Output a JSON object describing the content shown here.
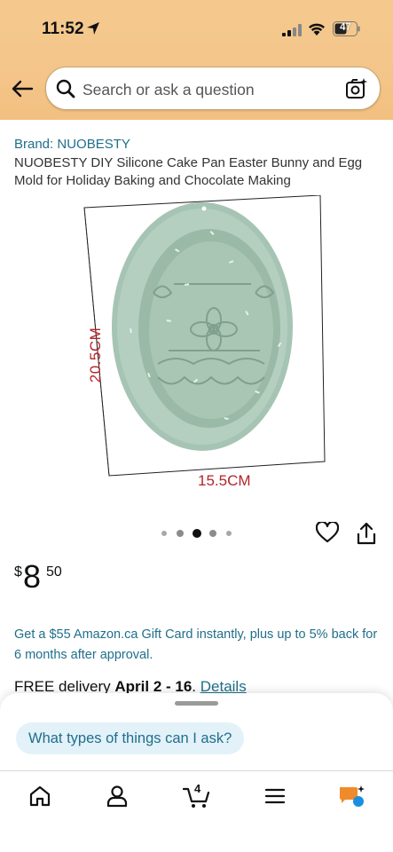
{
  "status_bar": {
    "time": "11:52",
    "battery": "47"
  },
  "search": {
    "placeholder": "Search or ask a question"
  },
  "product": {
    "brand": "Brand: NUOBESTY",
    "title": "NUOBESTY DIY Silicone Cake Pan Easter Bunny and Egg Mold for Holiday Baking and Chocolate Making",
    "image_labels": {
      "height": "20.5CM",
      "width": "15.5CM"
    },
    "image_count": 5,
    "image_active_index": 2,
    "price": {
      "currency": "$",
      "whole": "8",
      "fraction": "50"
    }
  },
  "promo": {
    "text": "Get a $55 Amazon.ca Gift Card instantly, plus up to 5% back for 6 months after approval."
  },
  "delivery": {
    "prefix": "FREE delivery ",
    "dates": "April 2 - 16",
    "suffix": ". ",
    "details_link": "Details"
  },
  "assistant": {
    "prompt_chip": "What types of things can I ask?"
  },
  "tabbar": {
    "cart_count": "4"
  },
  "colors": {
    "header": "#f4c58a",
    "link": "#1f6f8b",
    "chip_bg": "#e3f1f9",
    "mold": "#9fbfae"
  }
}
